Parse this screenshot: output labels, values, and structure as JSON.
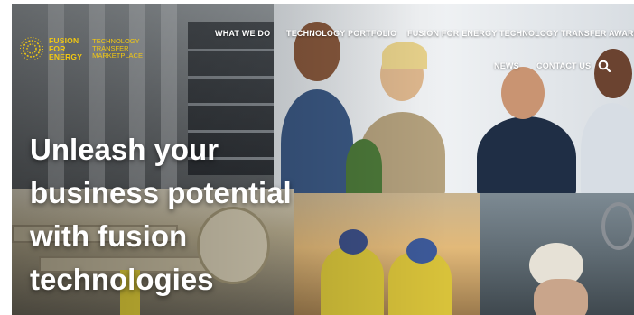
{
  "brand": {
    "name_lines": [
      "FUSION",
      "FOR",
      "ENERGY"
    ],
    "sub_lines": [
      "TECHNOLOGY",
      "TRANSFER",
      "MARKETPLACE"
    ],
    "accent_color": "#f2c811"
  },
  "nav": {
    "items": [
      {
        "label": "WHAT WE DO"
      },
      {
        "label": "TECHNOLOGY PORTFOLIO"
      },
      {
        "label": "FUSION FOR ENERGY TECHNOLOGY TRANSFER AWARD"
      },
      {
        "label": "NEWS"
      },
      {
        "label": "CONTACT US"
      }
    ],
    "search_icon": "search-icon"
  },
  "hero": {
    "headline_lines": [
      "Unleash your",
      "business potential",
      "with fusion",
      "technologies"
    ]
  }
}
